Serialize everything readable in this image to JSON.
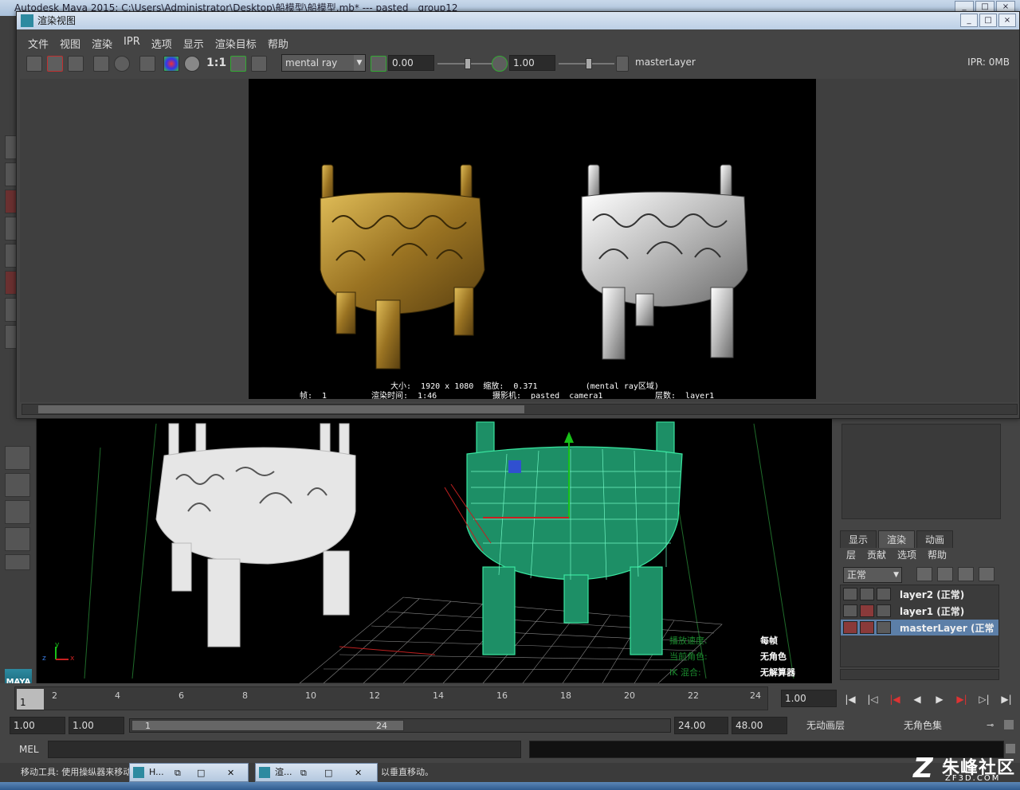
{
  "maya_window": {
    "title": "Autodesk Maya 2015: C:\\Users\\Administrator\\Desktop\\船模型\\船模型.mb*   ---   pasted__group12"
  },
  "render_view": {
    "title": "渲染视图",
    "menu": [
      "文件",
      "视图",
      "渲染",
      "IPR",
      "选项",
      "显示",
      "渲染目标",
      "帮助"
    ],
    "toolbar": {
      "ratio_label": "1:1",
      "renderer": "mental ray",
      "exposure": "0.00",
      "gamma": "1.00",
      "render_layer": "masterLayer",
      "ipr_status": "IPR: 0MB"
    },
    "image_info": {
      "line1": "大小:  1920 x 1080  缩放:  0.371          (mental ray区域)",
      "frame": "帧:  1",
      "render_time": "渲染时间:  1:46",
      "camera": "摄影机:  pasted__camera1",
      "layer": "层数:  layer1"
    }
  },
  "viewport": {
    "hud": {
      "playback_speed_label": "播放速度:",
      "playback_speed_value": "每帧",
      "camera_color_label": "当前角色:",
      "camera_color_value": "无角色",
      "ik_label": "IK 混合:",
      "ik_value": "无解算器"
    },
    "axis": {
      "x": "x",
      "y": "y",
      "z": "z"
    }
  },
  "layer_editor": {
    "tabs": [
      "显示",
      "渲染",
      "动画"
    ],
    "active_tab": "渲染",
    "menu": [
      "层",
      "贡献",
      "选项",
      "帮助"
    ],
    "blend_mode": "正常",
    "layers": [
      {
        "name": "layer2 (正常)",
        "selected": false
      },
      {
        "name": "layer1 (正常)",
        "selected": false
      },
      {
        "name": "masterLayer (正常",
        "selected": true
      }
    ]
  },
  "time_slider": {
    "current_frame": "1",
    "ticks": [
      "2",
      "4",
      "6",
      "8",
      "10",
      "12",
      "14",
      "16",
      "18",
      "20",
      "22",
      "24"
    ],
    "current_time": "1.00"
  },
  "range_slider": {
    "start_time": "1.00",
    "playback_start": "1.00",
    "range_start": "1",
    "range_end": "24",
    "playback_end": "24.00",
    "end_time": "48.00",
    "anim_layer": "无动画层",
    "character_set": "无角色集"
  },
  "command_line": {
    "label": "MEL"
  },
  "help_line": {
    "text": "移动工具: 使用操纵器来移动对象。使用鼠标中键单击可以在其中任何一个方向约束移动，使用鼠标中键可以垂直移动。",
    "visible_left": "移动工具: 使用操纵器来移动",
    "visible_right": "以垂直移动。"
  },
  "taskbar": {
    "items": [
      {
        "label": "H..."
      },
      {
        "label": "渲..."
      }
    ]
  },
  "watermark": {
    "name": "朱峰社区",
    "url": "ZF3D.COM"
  },
  "colors": {
    "wireframe": "#39e6a0",
    "gold": "#b08a30",
    "silver": "#d8d8d8",
    "selected_layer": "#5c7fa8"
  }
}
